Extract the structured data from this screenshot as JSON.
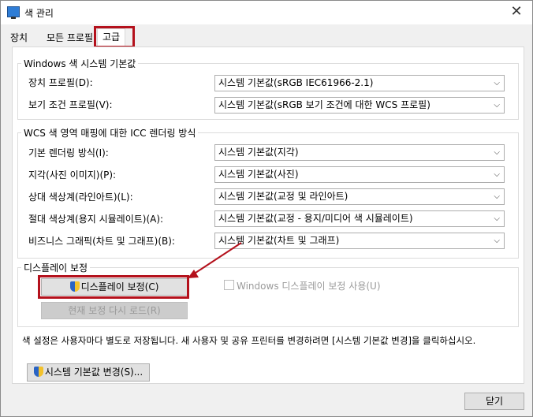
{
  "window": {
    "title": "색 관리",
    "close_symbol": "✕"
  },
  "tabs": [
    {
      "label": "장치"
    },
    {
      "label": "모든 프로필"
    },
    {
      "label": "고급"
    }
  ],
  "defaults_group": {
    "title": "Windows 색 시스템 기본값",
    "rows": [
      {
        "label": "장치 프로필(D):",
        "value": "시스템 기본값(sRGB IEC61966-2.1)"
      },
      {
        "label": "보기 조건 프로필(V):",
        "value": "시스템 기본값(sRGB 보기 조건에 대한 WCS 프로필)"
      }
    ]
  },
  "icc_group": {
    "title": "WCS 색 영역 매핑에 대한 ICC 렌더링 방식",
    "rows": [
      {
        "label": "기본 렌더링 방식(I):",
        "value": "시스템 기본값(지각)"
      },
      {
        "label": "지각(사진 이미지)(P):",
        "value": "시스템 기본값(사진)"
      },
      {
        "label": "상대 색상계(라인아트)(L):",
        "value": "시스템 기본값(교정 및 라인아트)"
      },
      {
        "label": "절대 색상계(용지 시뮬레이트)(A):",
        "value": "시스템 기본값(교정 - 용지/미디어 색 시뮬레이트)"
      },
      {
        "label": "비즈니스 그래픽(차트 및 그래프)(B):",
        "value": "시스템 기본값(차트 및 그래프)"
      }
    ]
  },
  "calibration_group": {
    "title": "디스플레이 보정",
    "calibrate_button": "디스플레이 보정(C)",
    "reload_button": "현재 보정 다시 로드(R)",
    "use_calibration_checkbox": "Windows 디스플레이 보정 사용(U)"
  },
  "info_text": "색 설정은 사용자마다 별도로 저장됩니다. 새 사용자 및 공유 프린터를 변경하려면 [시스템 기본값 변경]을 클릭하십시오.",
  "change_defaults_button": "시스템 기본값 변경(S)...",
  "close_button": "닫기",
  "icons": {
    "app": "monitor-icon",
    "shield": "uac-shield-icon",
    "dropdown": "chevron-down-icon"
  },
  "colors": {
    "highlight": "#b4111c",
    "panel_bg": "#ffffff",
    "window_bg": "#f0f0f0"
  }
}
